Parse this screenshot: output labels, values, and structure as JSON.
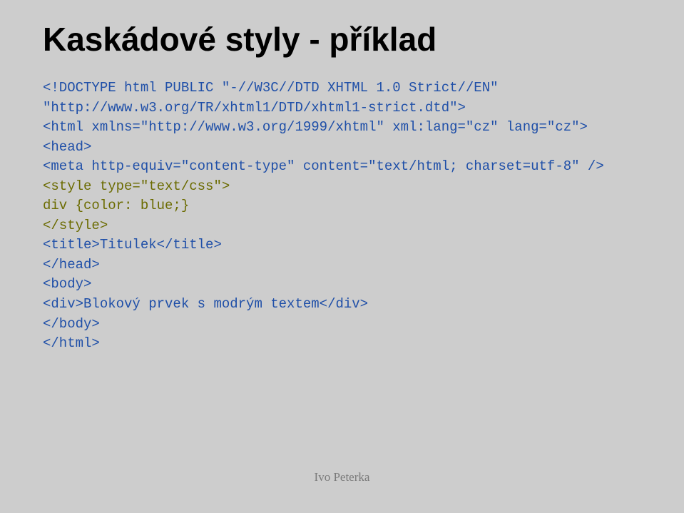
{
  "title": "Kaskádové styly - příklad",
  "code": {
    "l1": "<!DOCTYPE html PUBLIC \"-//W3C//DTD XHTML 1.0 Strict//EN\"",
    "l2": "\"http://www.w3.org/TR/xhtml1/DTD/xhtml1-strict.dtd\">",
    "l3": "<html xmlns=\"http://www.w3.org/1999/xhtml\" xml:lang=\"cz\" lang=\"cz\">",
    "l4": "<head>",
    "l5": "<meta http-equiv=\"content-type\" content=\"text/html; charset=utf-8\" />",
    "l6": "<style type=\"text/css\">",
    "l7": "div {color: blue;}",
    "l8": "</style>",
    "l9": "<title>Titulek</title>",
    "l10": "</head>",
    "l11": "<body>",
    "l12": "<div>Blokový prvek s modrým textem</div>",
    "l13": "</body>",
    "l14": "</html>"
  },
  "footer": "Ivo Peterka"
}
